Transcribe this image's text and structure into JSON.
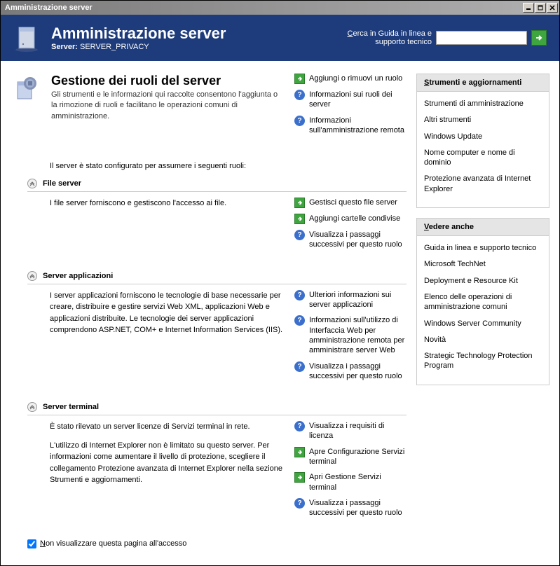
{
  "titlebar": {
    "text": "Amministrazione server"
  },
  "header": {
    "title": "Amministrazione server",
    "server_label": "Server:",
    "server_name": "SERVER_PRIVACY",
    "search_label_prefix": "C",
    "search_label_rest": "erca in Guida in linea e supporto tecnico"
  },
  "page": {
    "title": "Gestione dei ruoli del server",
    "description": "Gli strumenti e le informazioni qui raccolte consentono l'aggiunta o la rimozione di ruoli e facilitano le operazioni comuni di amministrazione.",
    "intro": "Il server è stato configurato per assumere i seguenti ruoli:"
  },
  "top_links": [
    {
      "icon": "green",
      "text": "Aggiungi o rimuovi un ruolo"
    },
    {
      "icon": "help",
      "text": "Informazioni sui ruoli dei server"
    },
    {
      "icon": "help",
      "text": "Informazioni sull'amministrazione remota"
    }
  ],
  "roles": [
    {
      "title": "File server",
      "description": "I file server forniscono e gestiscono l'accesso ai file.",
      "links": [
        {
          "icon": "green",
          "text": "Gestisci questo file server"
        },
        {
          "icon": "green",
          "text": "Aggiungi cartelle condivise"
        },
        {
          "icon": "help",
          "text": "Visualizza i passaggi successivi per questo ruolo"
        }
      ]
    },
    {
      "title": "Server applicazioni",
      "description": "I server applicazioni forniscono le tecnologie di base necessarie per creare, distribuire e gestire servizi Web XML, applicazioni Web e applicazioni distribuite. Le tecnologie dei server applicazioni comprendono ASP.NET, COM+ e Internet Information Services (IIS).",
      "links": [
        {
          "icon": "help",
          "text": "Ulteriori informazioni sui server applicazioni"
        },
        {
          "icon": "help",
          "text": "Informazioni sull'utilizzo di Interfaccia Web per amministrazione remota per amministrare server Web"
        },
        {
          "icon": "help",
          "text": "Visualizza i passaggi successivi per questo ruolo"
        }
      ]
    },
    {
      "title": "Server terminal",
      "description": "È stato rilevato un server licenze di Servizi terminal in rete.\n\nL'utilizzo di Internet Explorer non è limitato su questo server. Per informazioni come aumentare il livello di protezione, scegliere il collegamento Protezione avanzata di Internet Explorer nella sezione Strumenti e aggiornamenti.",
      "links": [
        {
          "icon": "help",
          "text": "Visualizza i requisiti di licenza"
        },
        {
          "icon": "green",
          "text": "Apre Configurazione Servizi terminal"
        },
        {
          "icon": "green",
          "text": "Apri Gestione Servizi terminal"
        },
        {
          "icon": "help",
          "text": "Visualizza i passaggi successivi per questo ruolo"
        }
      ]
    }
  ],
  "sidebar": {
    "tools_title": "Strumenti e aggiornamenti",
    "tools_underline": "S",
    "tools_links": [
      "Strumenti di amministrazione",
      "Altri strumenti",
      "Windows Update",
      "Nome computer e nome di dominio",
      "Protezione avanzata di Internet Explorer"
    ],
    "see_also_title": "edere anche",
    "see_also_underline": "V",
    "see_also_links": [
      "Guida in linea e supporto tecnico",
      "Microsoft TechNet",
      "Deployment e Resource Kit",
      "Elenco delle operazioni di amministrazione comuni",
      "Windows Server Community",
      "Novità",
      "Strategic Technology Protection Program"
    ]
  },
  "footer": {
    "checkbox_underline": "N",
    "checkbox_label": "on visualizzare questa pagina all'accesso"
  }
}
